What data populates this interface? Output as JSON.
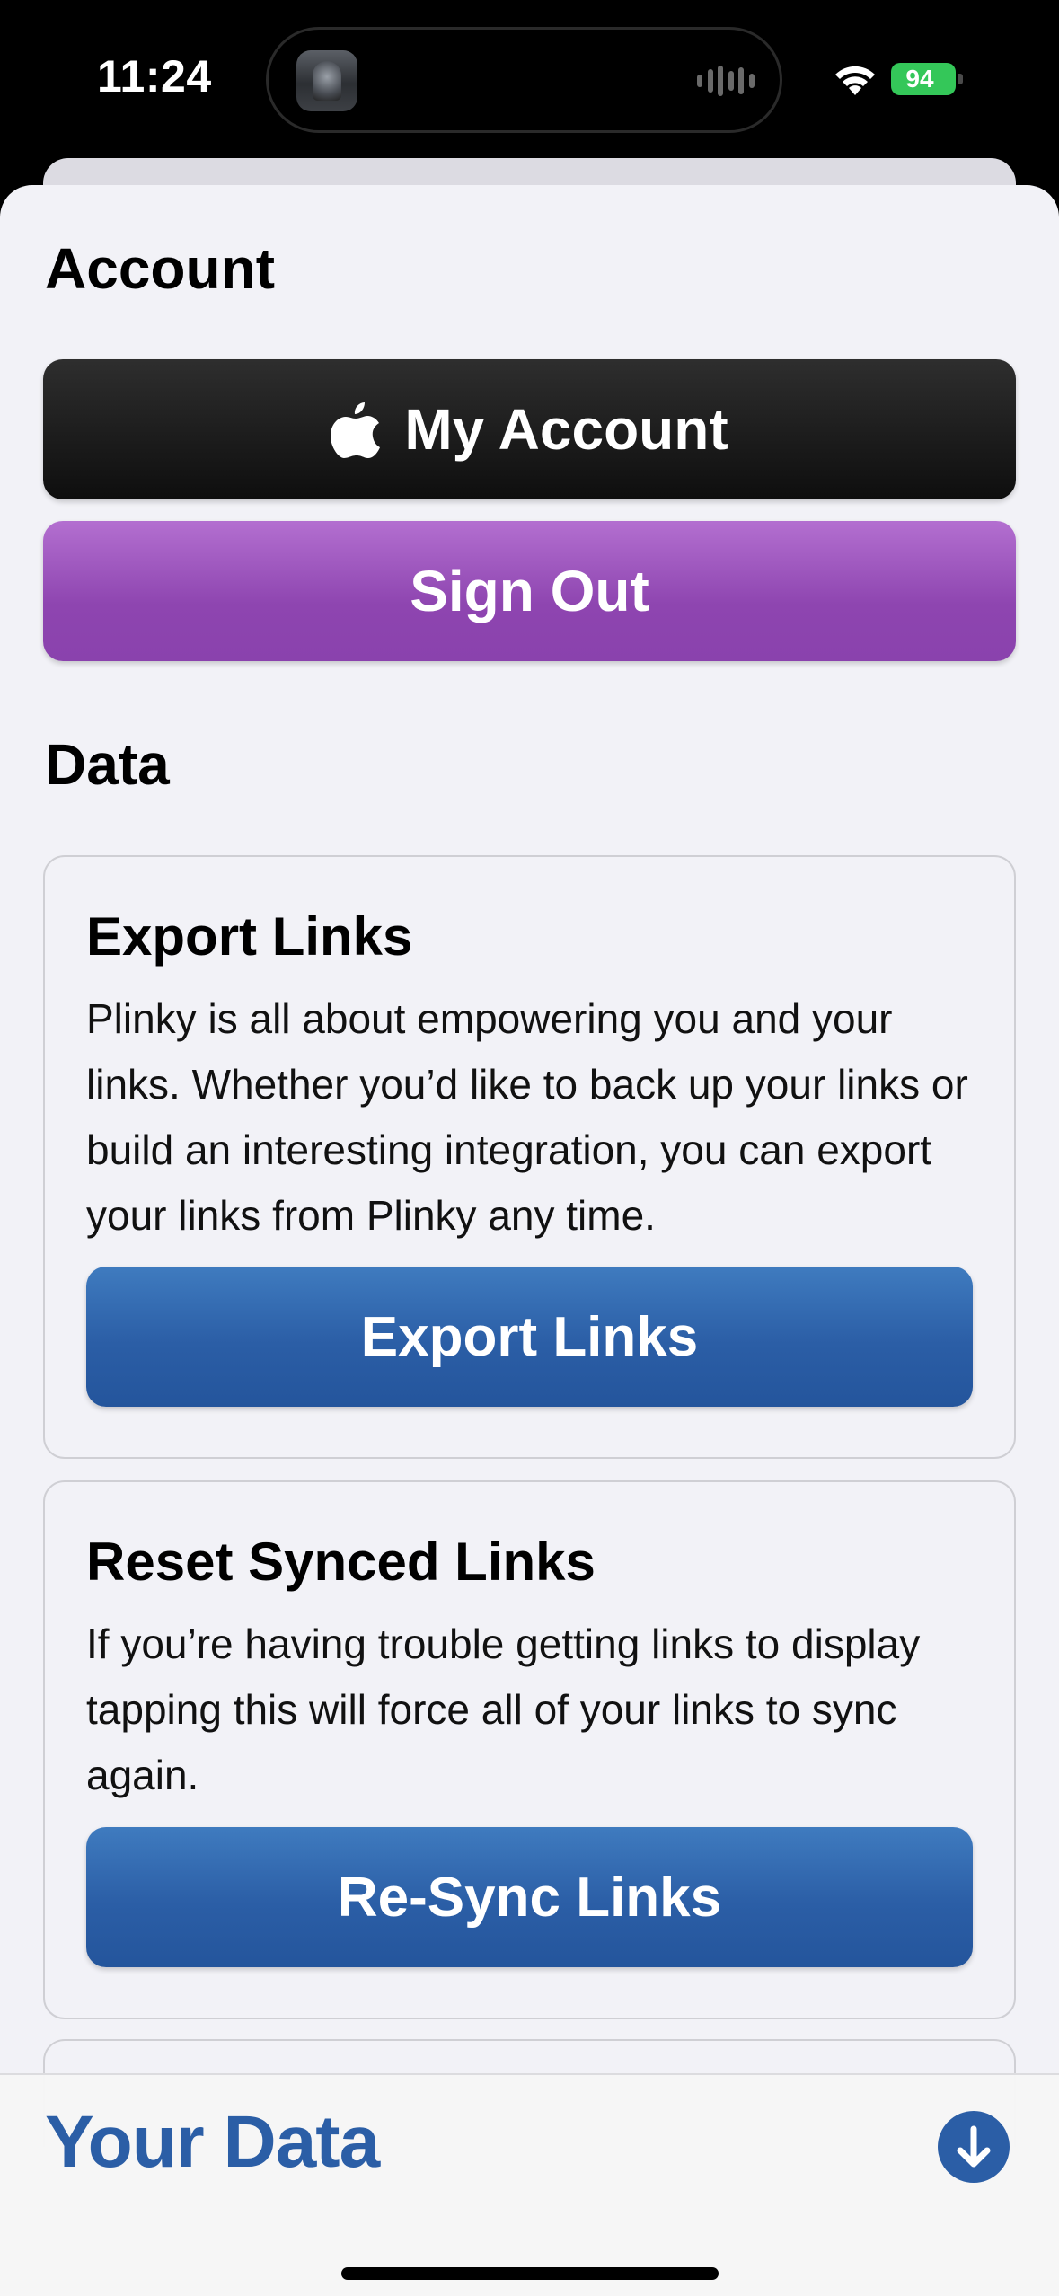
{
  "status_bar": {
    "time": "11:24",
    "battery": "94"
  },
  "account": {
    "title": "Account",
    "my_account_label": "My Account",
    "sign_out_label": "Sign Out"
  },
  "data_section": {
    "title": "Data",
    "export_card": {
      "title": "Export Links",
      "body": "Plinky is all about empowering you and your links. Whether you’d like to back up your links or build an interesting integration, you can export your links from Plinky any time.",
      "button_label": "Export Links"
    },
    "resync_card": {
      "title": "Reset Synced Links",
      "body": "If you’re having trouble getting links to display tapping this will force all of your links to sync again.",
      "button_label": "Re-Sync Links"
    }
  },
  "bottom_bar": {
    "title": "Your Data"
  },
  "colors": {
    "accent_blue": "#2b5ea6",
    "sign_out_purple": "#9b55bd",
    "account_black": "#141414",
    "battery_green": "#34c759"
  },
  "icons": [
    "apple-icon",
    "wifi-icon",
    "battery-icon",
    "waveform-icon",
    "arrow-down-circle-icon"
  ]
}
